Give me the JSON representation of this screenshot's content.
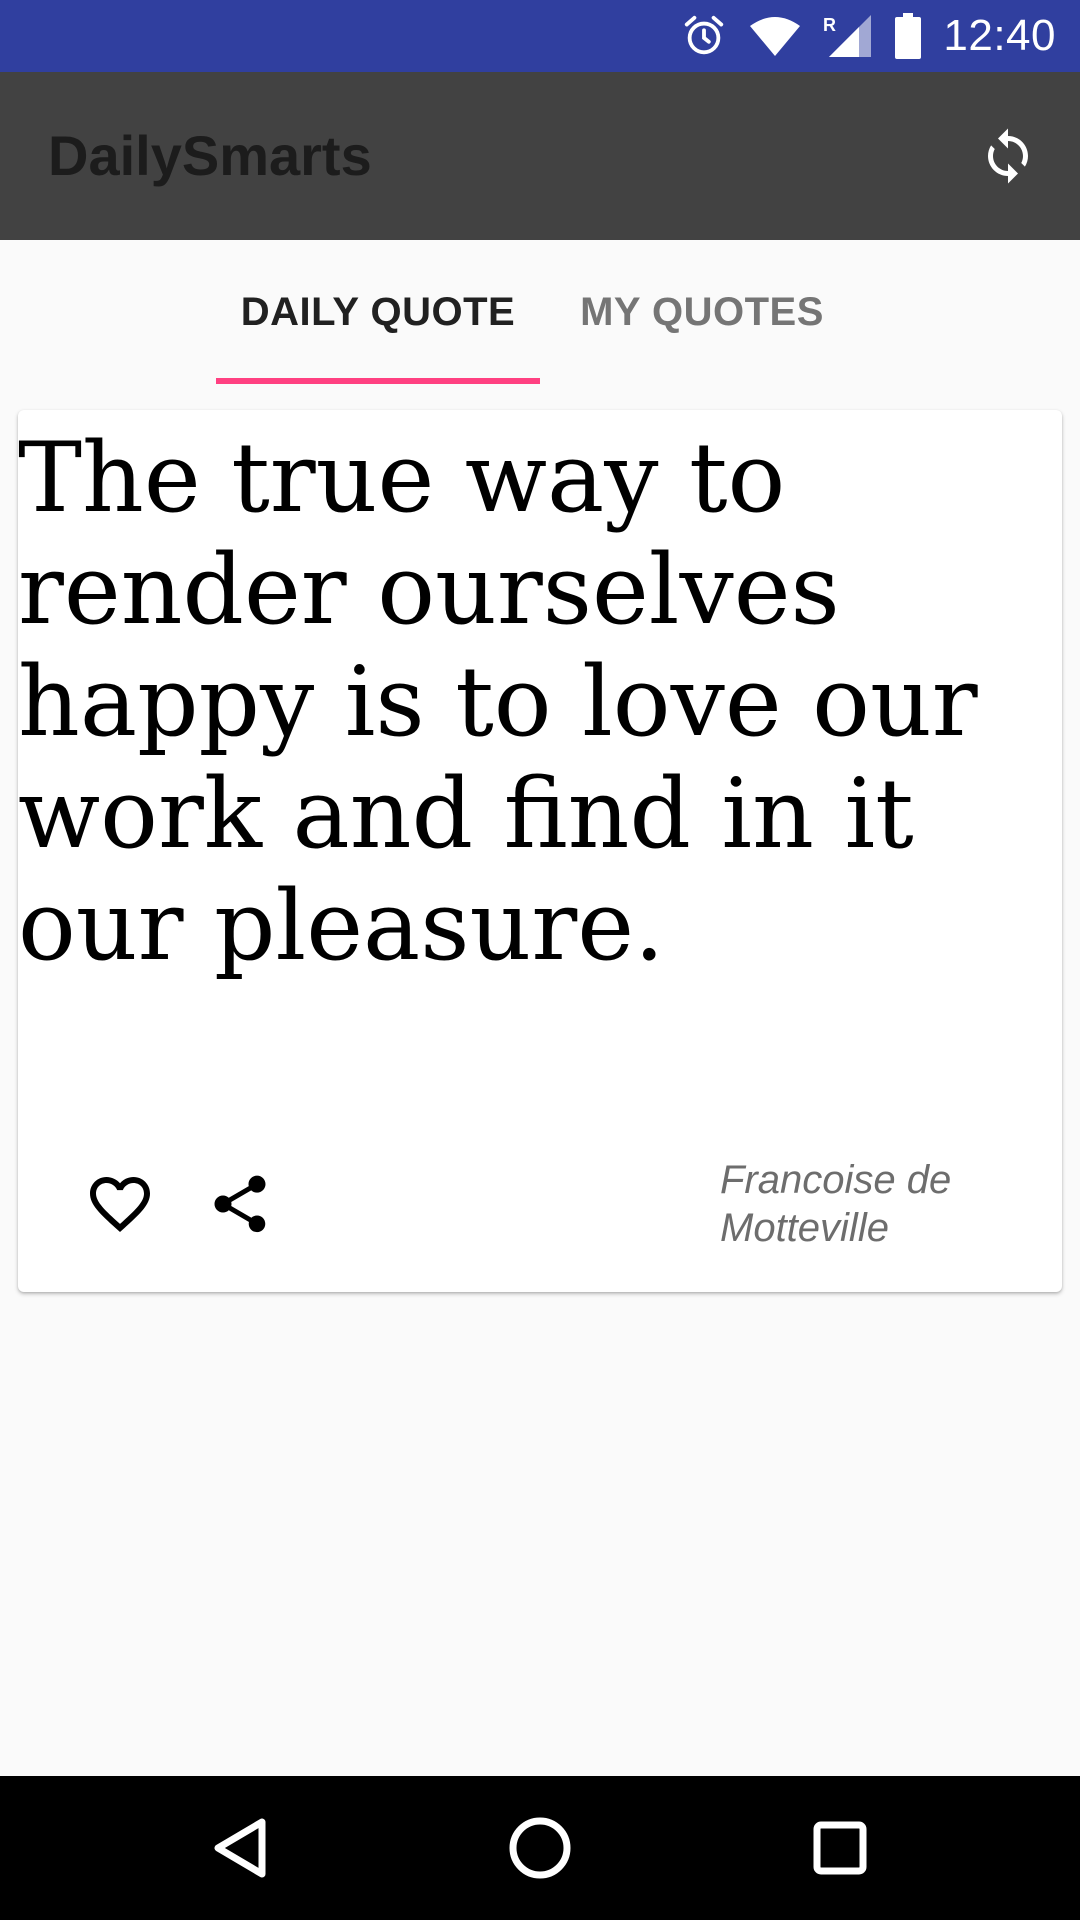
{
  "status_bar": {
    "time": "12:40",
    "icons": [
      "alarm-icon",
      "wifi-icon",
      "signal-roaming-icon",
      "battery-icon"
    ],
    "roaming_label": "R",
    "background": "#303f9f"
  },
  "app_bar": {
    "title": "DailySmarts",
    "action_icon": "refresh-icon",
    "background": "#424242"
  },
  "tabs": [
    {
      "label": "DAILY QUOTE",
      "selected": true
    },
    {
      "label": "MY QUOTES",
      "selected": false
    }
  ],
  "tab_indicator_color": "#ff4081",
  "quote_card": {
    "text": "The true way to render ourselves happy is to love our work and find in it our pleasure.",
    "author": "Francoise de Motteville",
    "actions": [
      "heart-outline-icon",
      "share-icon"
    ]
  },
  "nav_bar": {
    "buttons": [
      "back-icon",
      "home-icon",
      "recents-icon"
    ]
  }
}
